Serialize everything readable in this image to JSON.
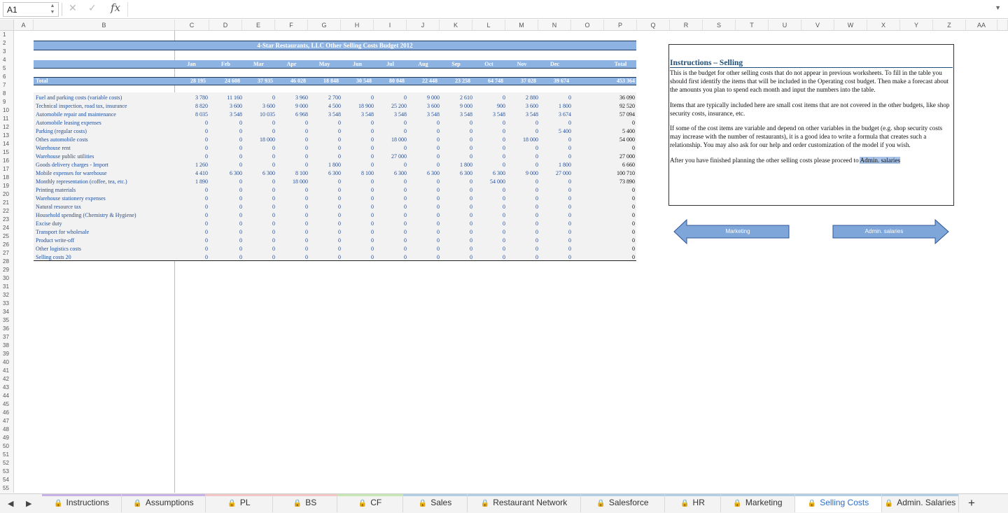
{
  "formula_bar": {
    "cell_ref": "A1",
    "fx": "fx",
    "value": ""
  },
  "columns": [
    "A",
    "B",
    "C",
    "D",
    "E",
    "F",
    "G",
    "H",
    "I",
    "J",
    "K",
    "L",
    "M",
    "N",
    "O",
    "P",
    "Q",
    "R",
    "S",
    "T",
    "U",
    "V",
    "W",
    "X",
    "Y",
    "Z",
    "AA"
  ],
  "rows_count": 55,
  "table": {
    "title": "4-Star Restaurants, LLC Other Selling Costs Budget 2012",
    "months": [
      "Jan",
      "Feb",
      "Mar",
      "Apr",
      "May",
      "Jun",
      "Jul",
      "Aug",
      "Sep",
      "Oct",
      "Nov",
      "Dec"
    ],
    "total_header": "Total",
    "total_row": {
      "label": "Total",
      "values": [
        "28 195",
        "24 608",
        "37 935",
        "46 028",
        "18 848",
        "30 548",
        "80 048",
        "22 448",
        "23 258",
        "64 748",
        "37 028",
        "39 674"
      ],
      "total": "453 364"
    },
    "rows": [
      {
        "label": "Fuel and parking costs (variable costs)",
        "values": [
          "3 780",
          "11 160",
          "0",
          "3 960",
          "2 700",
          "0",
          "0",
          "9 000",
          "2 610",
          "0",
          "2 880",
          "0"
        ],
        "total": "36 090"
      },
      {
        "label": "Technical inspection, road tax, insurance",
        "values": [
          "8 820",
          "3 600",
          "3 600",
          "9 000",
          "4 500",
          "18 900",
          "25 200",
          "3 600",
          "9 000",
          "900",
          "3 600",
          "1 800"
        ],
        "total": "92 520"
      },
      {
        "label": "Automobile repair and maintenance",
        "values": [
          "8 035",
          "3 548",
          "10 035",
          "6 968",
          "3 548",
          "3 548",
          "3 548",
          "3 548",
          "3 548",
          "3 548",
          "3 548",
          "3 674"
        ],
        "total": "57 094"
      },
      {
        "label": "Automobile leasing expenses",
        "values": [
          "0",
          "0",
          "0",
          "0",
          "0",
          "0",
          "0",
          "0",
          "0",
          "0",
          "0",
          "0"
        ],
        "total": "0"
      },
      {
        "label": "Parking (regular costs)",
        "values": [
          "0",
          "0",
          "0",
          "0",
          "0",
          "0",
          "0",
          "0",
          "0",
          "0",
          "0",
          "5 400"
        ],
        "total": "5 400"
      },
      {
        "label": "Othes automobile costs",
        "values": [
          "0",
          "0",
          "18 000",
          "0",
          "0",
          "0",
          "18 000",
          "0",
          "0",
          "0",
          "18 000",
          "0"
        ],
        "total": "54 000"
      },
      {
        "label": "Warehouse rent",
        "values": [
          "0",
          "0",
          "0",
          "0",
          "0",
          "0",
          "0",
          "0",
          "0",
          "0",
          "0",
          "0"
        ],
        "total": "0"
      },
      {
        "label": "Warehouse public utilities",
        "values": [
          "0",
          "0",
          "0",
          "0",
          "0",
          "0",
          "27 000",
          "0",
          "0",
          "0",
          "0",
          "0"
        ],
        "total": "27 000"
      },
      {
        "label": "Goods delivery charges - Import",
        "values": [
          "1 260",
          "0",
          "0",
          "0",
          "1 800",
          "0",
          "0",
          "0",
          "1 800",
          "0",
          "0",
          "1 800"
        ],
        "total": "6 660"
      },
      {
        "label": "Mobile expenses for warehouse",
        "values": [
          "4 410",
          "6 300",
          "6 300",
          "8 100",
          "6 300",
          "8 100",
          "6 300",
          "6 300",
          "6 300",
          "6 300",
          "9 000",
          "27 000"
        ],
        "total": "100 710"
      },
      {
        "label": "Monthly representation (coffee, tea, etc.)",
        "values": [
          "1 890",
          "0",
          "0",
          "18 000",
          "0",
          "0",
          "0",
          "0",
          "0",
          "54 000",
          "0",
          "0"
        ],
        "total": "73 890"
      },
      {
        "label": "Printing materials",
        "values": [
          "0",
          "0",
          "0",
          "0",
          "0",
          "0",
          "0",
          "0",
          "0",
          "0",
          "0",
          "0"
        ],
        "total": "0"
      },
      {
        "label": "Warehouse stationery expenses",
        "values": [
          "0",
          "0",
          "0",
          "0",
          "0",
          "0",
          "0",
          "0",
          "0",
          "0",
          "0",
          "0"
        ],
        "total": "0"
      },
      {
        "label": "Natural resource tax",
        "values": [
          "0",
          "0",
          "0",
          "0",
          "0",
          "0",
          "0",
          "0",
          "0",
          "0",
          "0",
          "0"
        ],
        "total": "0"
      },
      {
        "label": "Household spending (Chemistry & Hygiene)",
        "values": [
          "0",
          "0",
          "0",
          "0",
          "0",
          "0",
          "0",
          "0",
          "0",
          "0",
          "0",
          "0"
        ],
        "total": "0"
      },
      {
        "label": "Excise duty",
        "values": [
          "0",
          "0",
          "0",
          "0",
          "0",
          "0",
          "0",
          "0",
          "0",
          "0",
          "0",
          "0"
        ],
        "total": "0"
      },
      {
        "label": "Transport for wholesale",
        "values": [
          "0",
          "0",
          "0",
          "0",
          "0",
          "0",
          "0",
          "0",
          "0",
          "0",
          "0",
          "0"
        ],
        "total": "0"
      },
      {
        "label": "Product write-off",
        "values": [
          "0",
          "0",
          "0",
          "0",
          "0",
          "0",
          "0",
          "0",
          "0",
          "0",
          "0",
          "0"
        ],
        "total": "0"
      },
      {
        "label": "Other logistics costs",
        "values": [
          "0",
          "0",
          "0",
          "0",
          "0",
          "0",
          "0",
          "0",
          "0",
          "0",
          "0",
          "0"
        ],
        "total": "0"
      },
      {
        "label": "Selling costs 20",
        "values": [
          "0",
          "0",
          "0",
          "0",
          "0",
          "0",
          "0",
          "0",
          "0",
          "0",
          "0",
          "0"
        ],
        "total": "0"
      }
    ]
  },
  "instructions": {
    "title": "Instructions – Selling",
    "p1": "This is the budget for other selling costs that do not appear in previous worksheets. To fill in the table you should first identify the items that will be included in the Operating cost budget. Then make a forecast about the amounts you plan to spend each month and input the numbers into the table.",
    "p2": "Items that are typically included here are small cost items that are not covered in the other budgets, like shop security costs, insurance, etc.",
    "p3": "If some of the cost items are variable and depend on other variables in the budget (e.g. shop security costs may increase with the number of restaurants), it is a good idea to write a formula that creates such a relationship. You may also ask for our help and order customization of the model if you wish.",
    "p4_prefix": "After you have finished planning the other selling costs please proceed to ",
    "p4_link": "Admin. salaries"
  },
  "nav_buttons": {
    "prev": "Marketing",
    "next": "Admin. salaries"
  },
  "tabs": [
    {
      "label": "Instructions",
      "color": "#c7b3e6"
    },
    {
      "label": "Assumptions",
      "color": "#c7b3e6"
    },
    {
      "label": "PL",
      "color": "#f2c6c6"
    },
    {
      "label": "BS",
      "color": "#f2c6c6"
    },
    {
      "label": "CF",
      "color": "#c6e6b3"
    },
    {
      "label": "Sales",
      "color": "#b3cfe6"
    },
    {
      "label": "Restaurant Network",
      "color": "#b3cfe6"
    },
    {
      "label": "Salesforce",
      "color": "#b3cfe6"
    },
    {
      "label": "HR",
      "color": "#b3cfe6"
    },
    {
      "label": "Marketing",
      "color": "#b3cfe6"
    },
    {
      "label": "Selling Costs",
      "color": "#b3cfe6",
      "active": true
    },
    {
      "label": "Admin. Salaries",
      "color": "#b3cfe6"
    }
  ]
}
